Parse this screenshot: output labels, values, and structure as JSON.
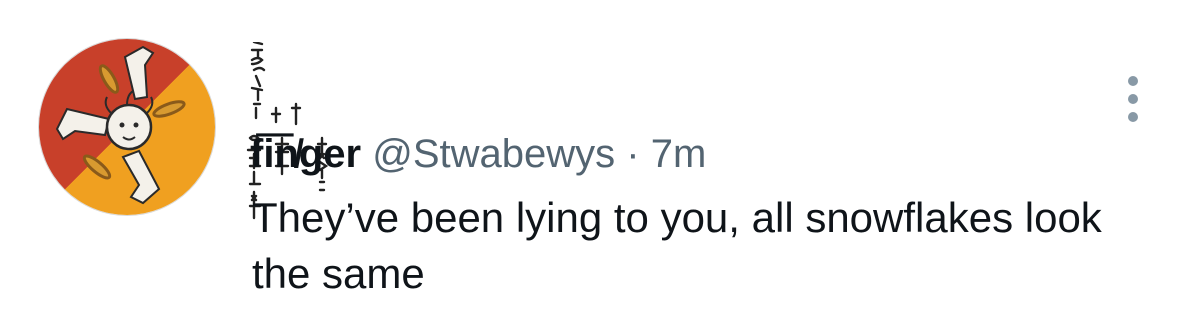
{
  "tweet": {
    "avatar_icon": "trinacria-logo",
    "display_name": "fi͞n̸ger",
    "handle": "@Stwabewys",
    "separator": "·",
    "timestamp": "7m",
    "text": "They’ve been lying to you, all snowflakes look the same",
    "more_icon": "more-options-icon"
  },
  "colors": {
    "text": "#0f1419",
    "secondary": "#536471",
    "avatar_red": "#c8402a",
    "avatar_orange": "#f0a020"
  }
}
